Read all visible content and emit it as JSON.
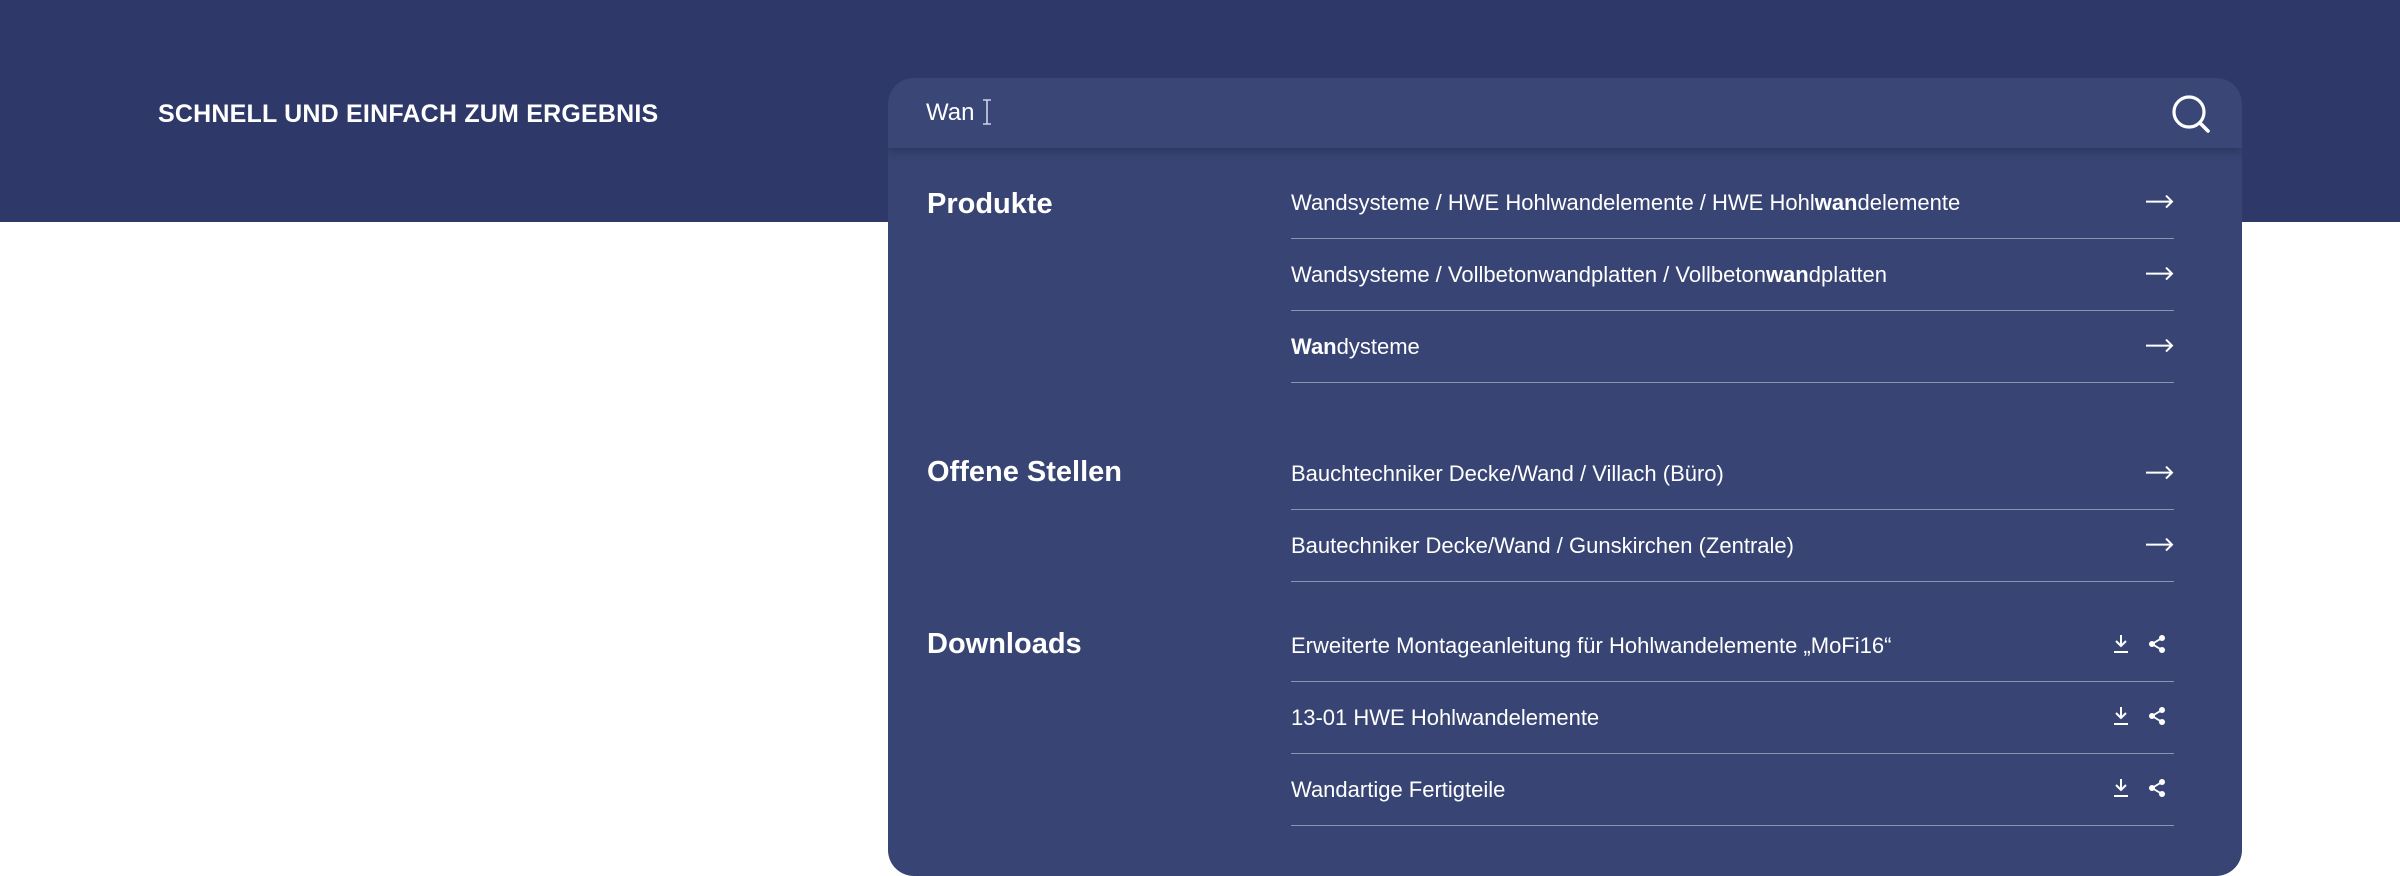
{
  "header": {
    "tagline": "SCHNELL UND EINFACH ZUM ERGEBNIS"
  },
  "search": {
    "value": "Wan",
    "placeholder": ""
  },
  "colors": {
    "header_bg": "#2e396a",
    "panel_bg": "#384574",
    "text": "#ffffff",
    "divider": "#8a93b4"
  },
  "groups": {
    "produkte": {
      "title": "Produkte",
      "items": [
        {
          "pre": "Wandsysteme / HWE Hohlwandelemente / HWE Hohl",
          "bold": "wan",
          "post": "delemente"
        },
        {
          "pre": "Wandsysteme / Vollbetonwandplatten / Vollbeton",
          "bold": "wan",
          "post": "dplatten"
        },
        {
          "pre": "",
          "bold": "Wan",
          "post": "dysteme"
        }
      ]
    },
    "stellen": {
      "title": "Offene Stellen",
      "items": [
        {
          "text": "Bauchtechniker Decke/Wand / Villach (Büro)"
        },
        {
          "text": "Bautechniker Decke/Wand / Gunskirchen (Zentrale)"
        }
      ]
    },
    "downloads": {
      "title": "Downloads",
      "items": [
        {
          "text": "Erweiterte Montageanleitung für Hohlwandelemente „MoFi16“"
        },
        {
          "text": "13-01 HWE Hohlwandelemente"
        },
        {
          "text": "Wandartige Fertigteile"
        }
      ]
    }
  },
  "icons": {
    "search": "search-icon",
    "arrow": "arrow-right-icon",
    "download": "download-icon",
    "share": "share-icon"
  }
}
